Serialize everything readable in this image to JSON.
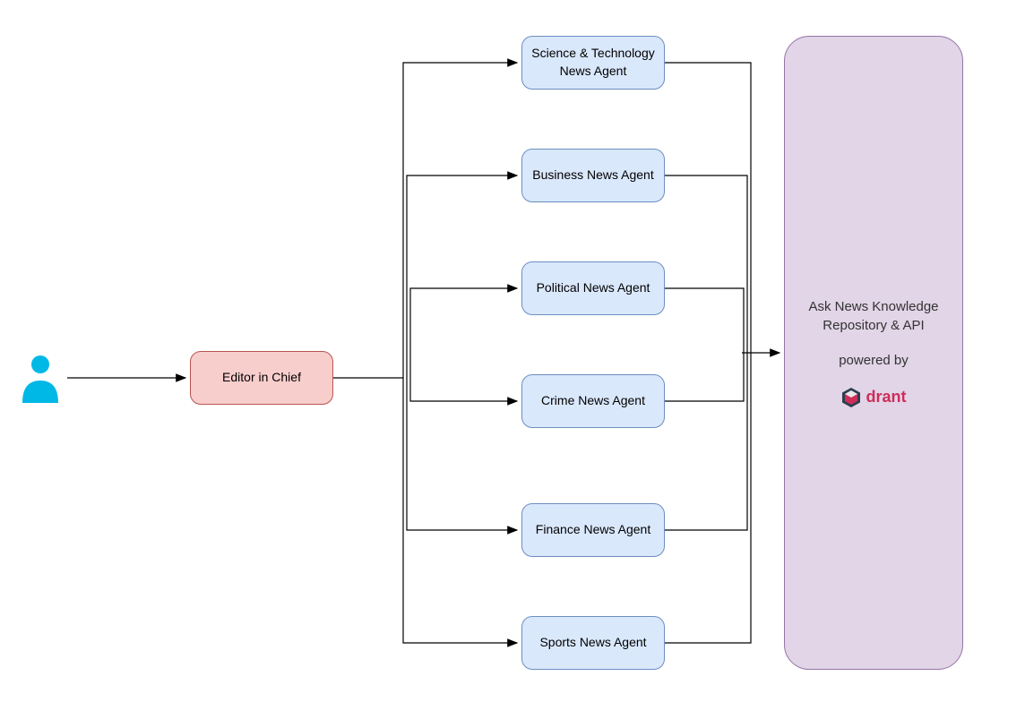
{
  "user": {
    "icon_name": "user-icon",
    "color": "#00b8e6"
  },
  "editor": {
    "label": "Editor in Chief",
    "bg": "#f8cecc",
    "border": "#b85450"
  },
  "agents": [
    {
      "label": "Science & Technology News Agent"
    },
    {
      "label": "Business News Agent"
    },
    {
      "label": "Political News Agent"
    },
    {
      "label": "Crime News Agent"
    },
    {
      "label": "Finance News Agent"
    },
    {
      "label": "Sports News Agent"
    }
  ],
  "agent_style": {
    "bg": "#dae8fc",
    "border": "#6c8ebf"
  },
  "repository": {
    "title": "Ask News Knowledge Repository & API",
    "powered_label": "powered by",
    "brand": "drant",
    "brand_color": "#cd2e5a",
    "bg": "#e1d5e7",
    "border": "#9673a6"
  },
  "chart_data": {
    "type": "diagram",
    "nodes": [
      {
        "id": "user",
        "label": "User",
        "kind": "actor"
      },
      {
        "id": "editor",
        "label": "Editor in Chief",
        "kind": "process"
      },
      {
        "id": "agent_scitech",
        "label": "Science & Technology News Agent",
        "kind": "agent"
      },
      {
        "id": "agent_business",
        "label": "Business News Agent",
        "kind": "agent"
      },
      {
        "id": "agent_political",
        "label": "Political News Agent",
        "kind": "agent"
      },
      {
        "id": "agent_crime",
        "label": "Crime News Agent",
        "kind": "agent"
      },
      {
        "id": "agent_finance",
        "label": "Finance News Agent",
        "kind": "agent"
      },
      {
        "id": "agent_sports",
        "label": "Sports News Agent",
        "kind": "agent"
      },
      {
        "id": "repo",
        "label": "Ask News Knowledge Repository & API (powered by Qdrant)",
        "kind": "datastore"
      }
    ],
    "edges": [
      {
        "from": "user",
        "to": "editor"
      },
      {
        "from": "editor",
        "to": "agent_scitech"
      },
      {
        "from": "editor",
        "to": "agent_business"
      },
      {
        "from": "editor",
        "to": "agent_political"
      },
      {
        "from": "editor",
        "to": "agent_crime"
      },
      {
        "from": "editor",
        "to": "agent_finance"
      },
      {
        "from": "editor",
        "to": "agent_sports"
      },
      {
        "from": "agent_scitech",
        "to": "repo"
      },
      {
        "from": "agent_business",
        "to": "repo"
      },
      {
        "from": "agent_political",
        "to": "repo"
      },
      {
        "from": "agent_crime",
        "to": "repo"
      },
      {
        "from": "agent_finance",
        "to": "repo"
      },
      {
        "from": "agent_sports",
        "to": "repo"
      }
    ]
  }
}
